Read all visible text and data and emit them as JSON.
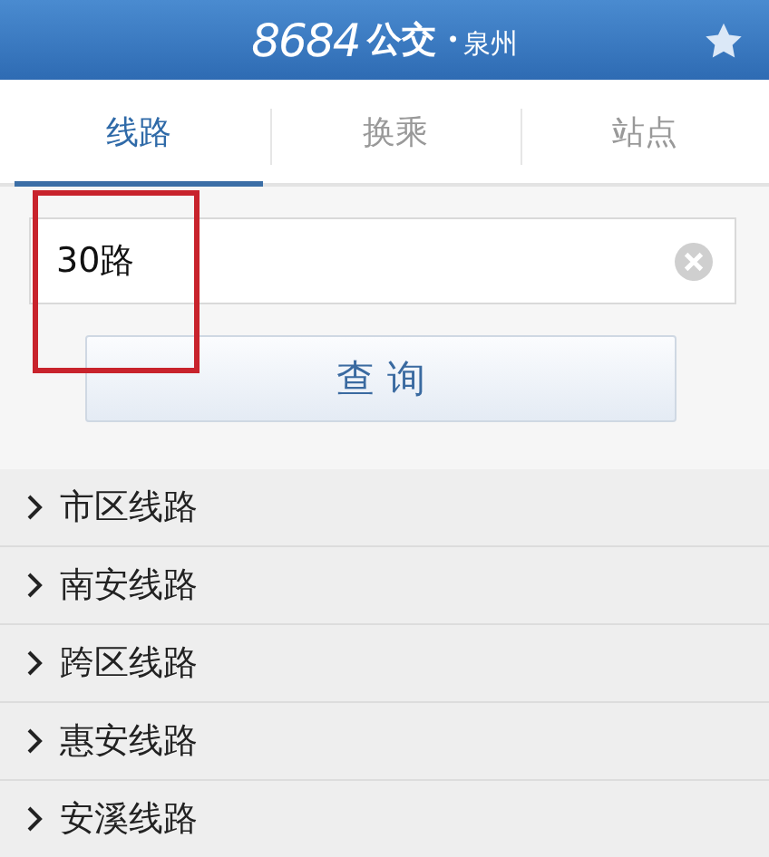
{
  "header": {
    "brand": "8684",
    "brand_suffix": "公交",
    "separator": "•",
    "city": "泉州",
    "favorite": false
  },
  "tabs": [
    {
      "label": "线路",
      "selected": true
    },
    {
      "label": "换乘",
      "selected": false
    },
    {
      "label": "站点",
      "selected": false
    }
  ],
  "search": {
    "value": "30路",
    "submit_label": "查 询"
  },
  "categories": [
    {
      "label": "市区线路",
      "expanded": false
    },
    {
      "label": "南安线路",
      "expanded": false
    },
    {
      "label": "跨区线路",
      "expanded": false
    },
    {
      "label": "惠安线路",
      "expanded": false
    },
    {
      "label": "安溪线路",
      "expanded": false
    }
  ],
  "annotations": [
    {
      "kind": "rectangle",
      "color": "#c8232c"
    }
  ]
}
